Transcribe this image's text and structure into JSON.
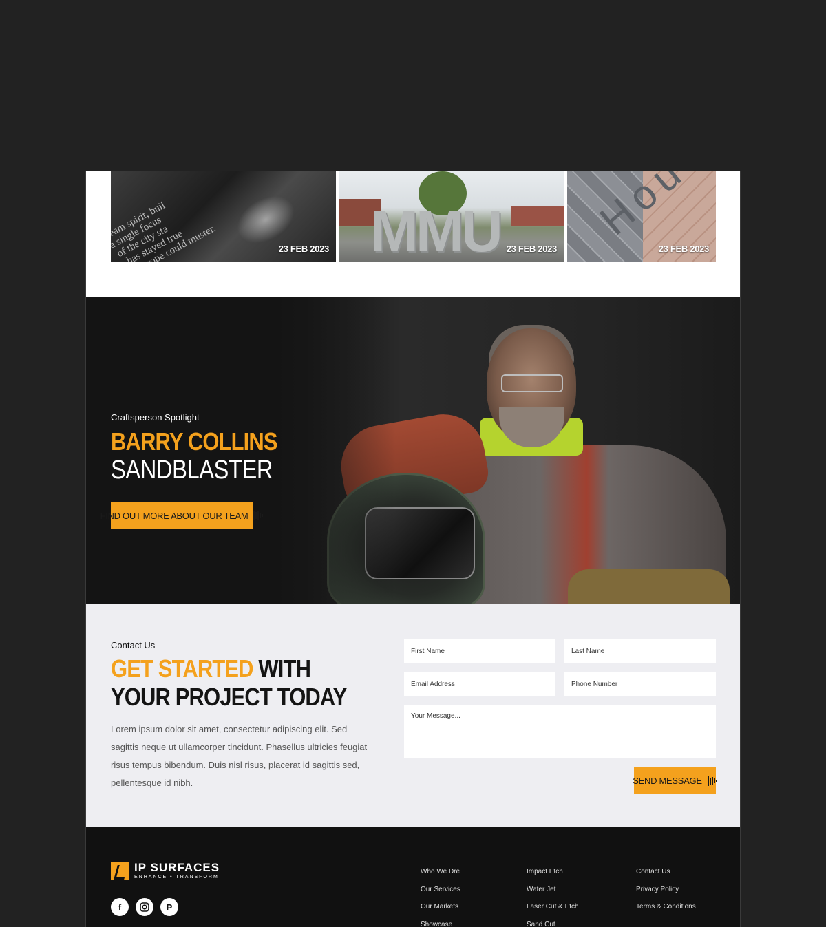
{
  "news": {
    "cards": [
      {
        "date": "23 FEB 2023"
      },
      {
        "date": "23 FEB 2023"
      },
      {
        "date": "23 FEB 2023"
      }
    ]
  },
  "spotlight": {
    "eyebrow": "Craftsperson Spotlight",
    "name": "BARRY COLLINS",
    "role": "SANDBLASTER",
    "button_label": "FIND OUT MORE ABOUT OUR TEAM"
  },
  "contact": {
    "eyebrow": "Contact Us",
    "title_highlight": "GET STARTED",
    "title_rest": " WITH YOUR PROJECT TODAY",
    "body": "Lorem ipsum dolor sit amet, consectetur adipiscing elit. Sed sagittis neque ut ullamcorper tincidunt. Phasellus ultricies feugiat risus tempus bibendum. Duis nisl risus, placerat id sagittis sed, pellentesque id nibh.",
    "form": {
      "first_name_placeholder": "First Name",
      "last_name_placeholder": "Last Name",
      "email_placeholder": "Email Address",
      "phone_placeholder": "Phone Number",
      "message_placeholder": "Your Message...",
      "send_label": "SEND MESSAGE"
    }
  },
  "footer": {
    "logo_name": "IP SURFACES",
    "logo_tagline": "ENHANCE • TRANSFORM",
    "socials": [
      "facebook-icon",
      "instagram-icon",
      "pinterest-icon"
    ],
    "columns": [
      [
        "Who We Dre",
        "Our Services",
        "Our Markets",
        "Showcase"
      ],
      [
        "Impact Etch",
        "Water Jet",
        "Laser Cut & Etch",
        "Sand Cut"
      ],
      [
        "Contact Us",
        "Privacy Policy",
        "Terms & Conditions"
      ]
    ]
  },
  "colors": {
    "accent": "#f4a11d",
    "page_bg": "#222222",
    "dark": "#141414",
    "contact_bg": "#eeeef2"
  }
}
